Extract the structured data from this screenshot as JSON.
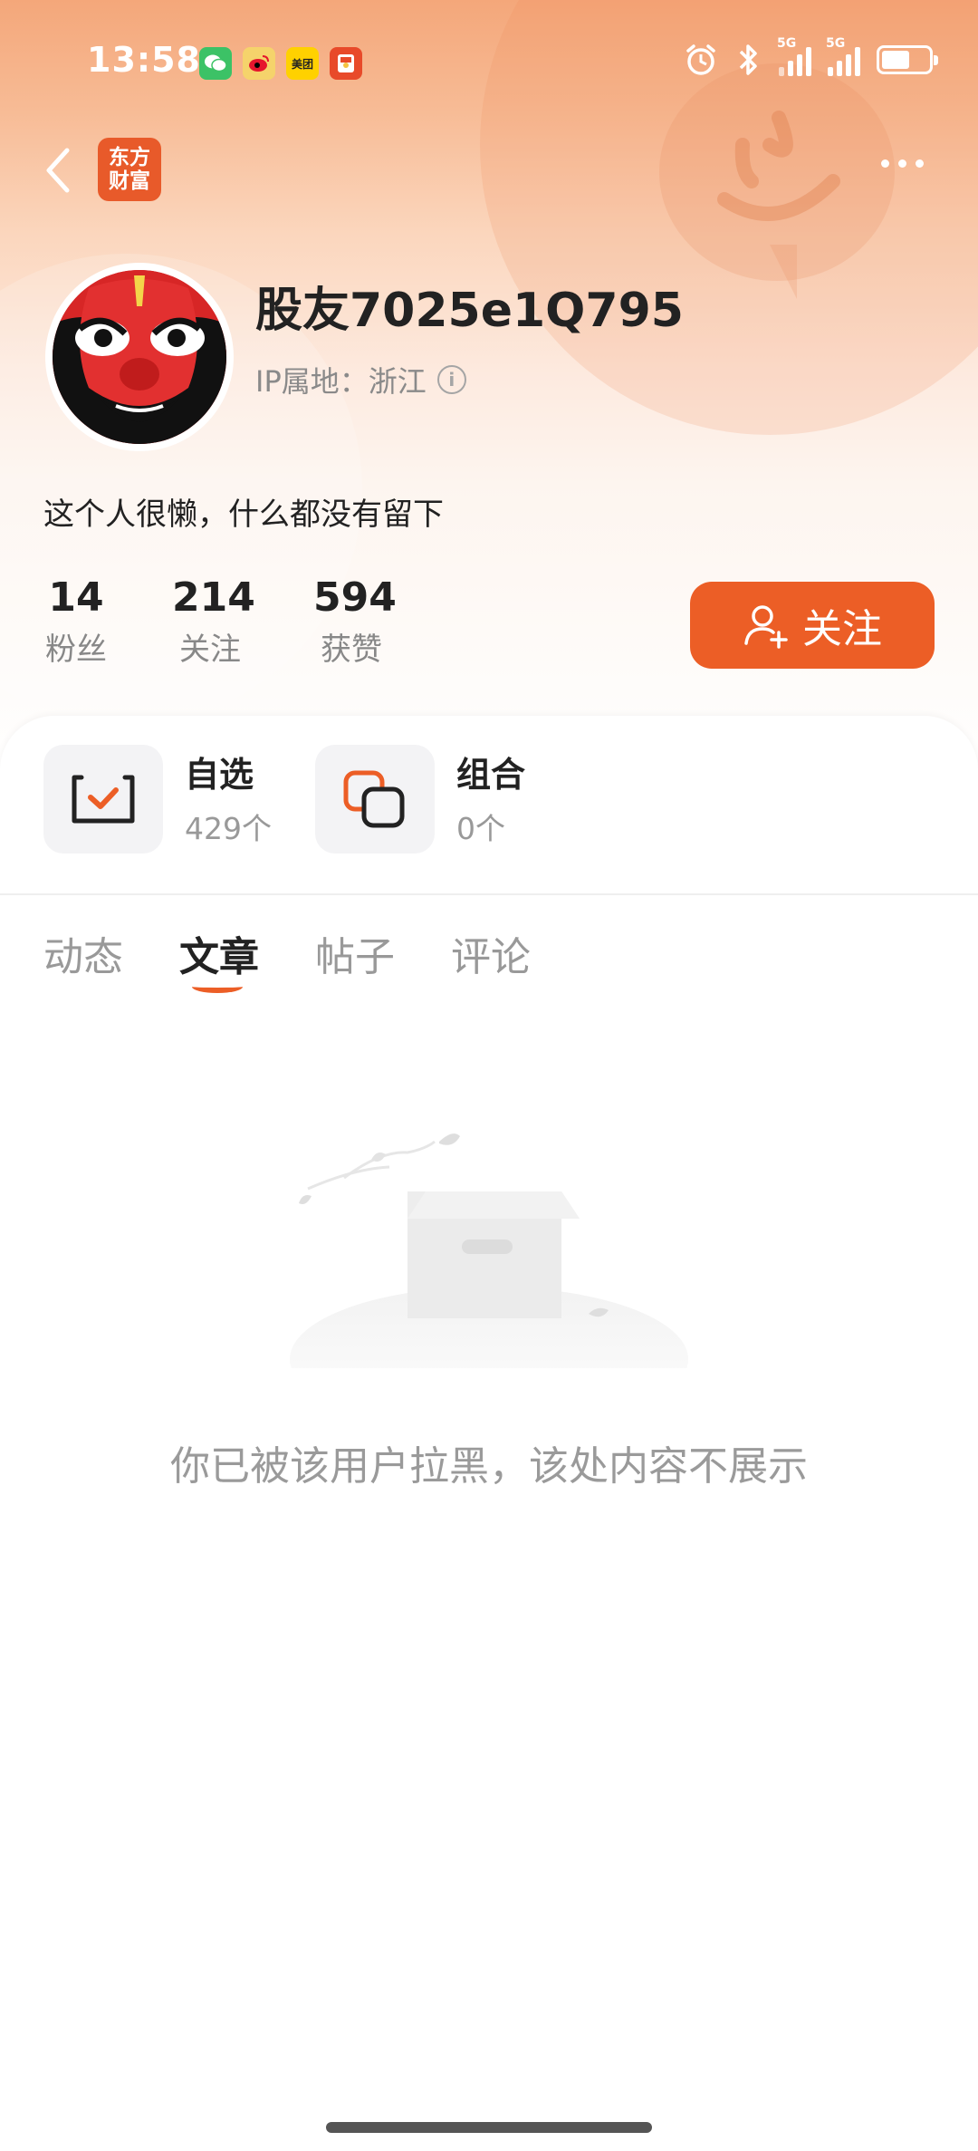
{
  "status_bar": {
    "time": "13:58",
    "apps": [
      "wechat-icon",
      "weibo-icon",
      "meituan-icon",
      "redpacket-icon"
    ],
    "meituan_label": "美团",
    "signal_labels": [
      "5G",
      "5G"
    ]
  },
  "nav": {
    "logo_line1": "东方",
    "logo_line2": "财富"
  },
  "profile": {
    "username": "股友7025e1Q795",
    "ip_location": "IP属地：浙江",
    "bio": "这个人很懒，什么都没有留下"
  },
  "stats": [
    {
      "value": "14",
      "label": "粉丝"
    },
    {
      "value": "214",
      "label": "关注"
    },
    {
      "value": "594",
      "label": "获赞"
    }
  ],
  "follow_button": {
    "label": "关注"
  },
  "features": [
    {
      "title": "自选",
      "count": "429个"
    },
    {
      "title": "组合",
      "count": "0个"
    }
  ],
  "tabs": [
    {
      "label": "动态",
      "active": false
    },
    {
      "label": "文章",
      "active": true
    },
    {
      "label": "帖子",
      "active": false
    },
    {
      "label": "评论",
      "active": false
    }
  ],
  "empty_state": {
    "message": "你已被该用户拉黑，该处内容不展示"
  },
  "colors": {
    "accent": "#ec5e26",
    "logo_bg": "#e85a2a"
  }
}
